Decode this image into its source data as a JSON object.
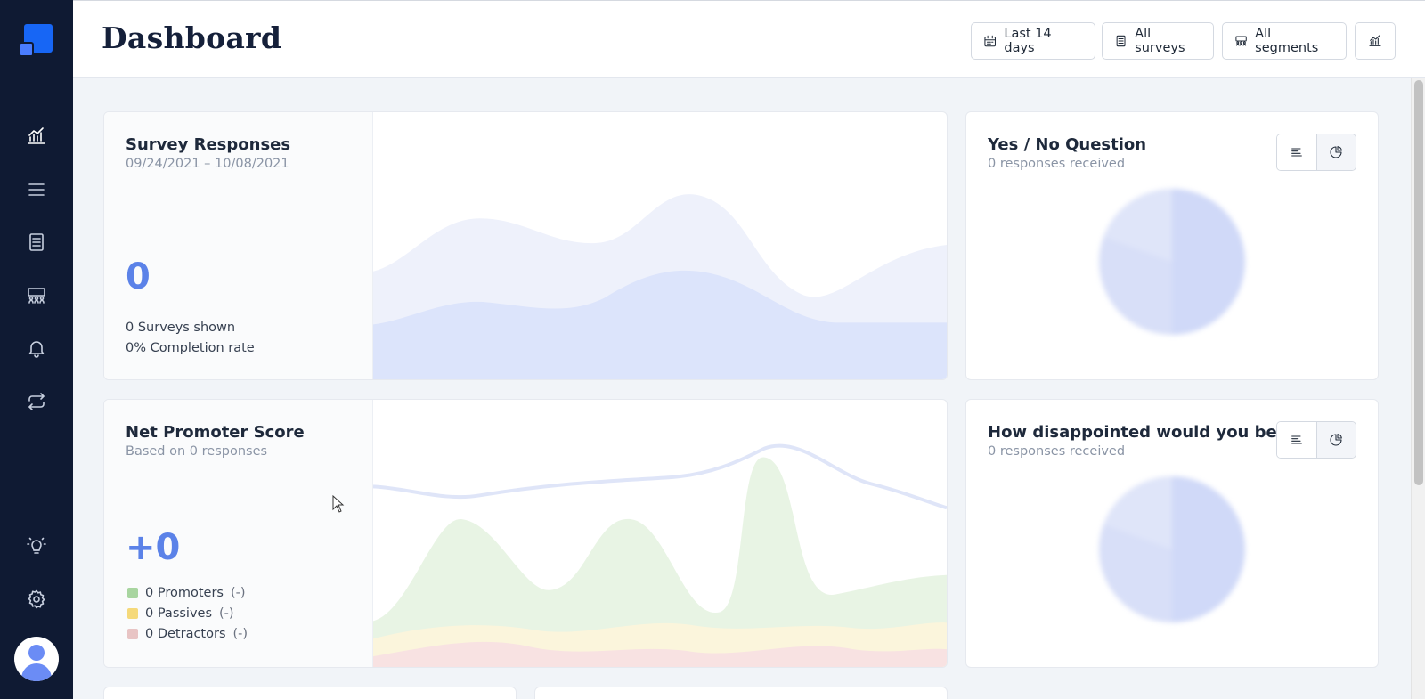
{
  "header": {
    "title": "Dashboard",
    "buttons": {
      "date_range": "Last 14 days",
      "surveys": "All surveys",
      "segments": "All segments"
    }
  },
  "sidebar": {
    "items": [
      {
        "name": "analytics",
        "icon": "chart-icon",
        "active": true
      },
      {
        "name": "list",
        "icon": "menu-lines-icon"
      },
      {
        "name": "surveys",
        "icon": "document-list-icon"
      },
      {
        "name": "segments",
        "icon": "users-group-icon"
      },
      {
        "name": "notifications",
        "icon": "bell-icon"
      },
      {
        "name": "integrations",
        "icon": "repeat-icon"
      },
      {
        "name": "ideas",
        "icon": "lightbulb-icon"
      },
      {
        "name": "settings",
        "icon": "gear-icon"
      }
    ]
  },
  "survey_responses": {
    "title": "Survey Responses",
    "date_range": "09/24/2021 – 10/08/2021",
    "count": "0",
    "surveys_shown": "0 Surveys shown",
    "completion_rate": "0% Completion rate"
  },
  "nps": {
    "title": "Net Promoter Score",
    "subtitle": "Based on 0 responses",
    "score": "+0",
    "legend": [
      {
        "label": "0 Promoters",
        "pct": "(-)",
        "color": "#a8d5a0"
      },
      {
        "label": "0 Passives",
        "pct": "(-)",
        "color": "#f5d97a"
      },
      {
        "label": "0 Detractors",
        "pct": "(-)",
        "color": "#e8c4c4"
      }
    ]
  },
  "yes_no": {
    "title": "Yes / No Question",
    "subtitle": "0 responses received"
  },
  "disappointed": {
    "title": "How disappointed would you be ...",
    "subtitle": "0 responses received"
  },
  "colors": {
    "sidebar": "#0f1a33",
    "accent": "#1766f5",
    "number": "#5b82e8"
  }
}
